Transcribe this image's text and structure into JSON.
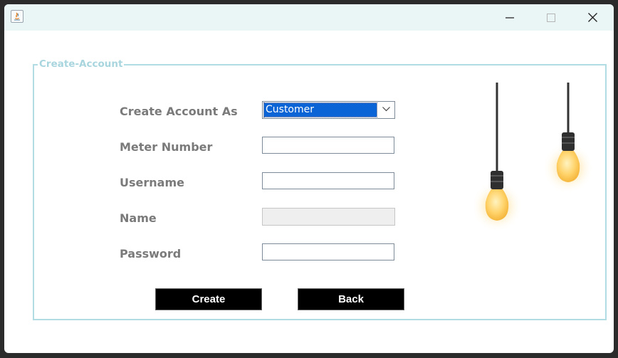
{
  "window": {
    "title": "",
    "controls": {
      "minimize": "minimize-icon",
      "maximize": "maximize-icon",
      "close": "close-icon"
    }
  },
  "panel": {
    "legend": "Create-Account"
  },
  "form": {
    "account_type": {
      "label": "Create Account As",
      "selected": "Customer"
    },
    "meter_number": {
      "label": "Meter Number",
      "value": ""
    },
    "username": {
      "label": "Username",
      "value": ""
    },
    "name": {
      "label": "Name",
      "value": ""
    },
    "password": {
      "label": "Password",
      "value": ""
    }
  },
  "buttons": {
    "create": "Create",
    "back": "Back"
  },
  "colors": {
    "accent_border": "#b2dce4",
    "legend_text": "#a8d5de",
    "label_text": "#7a7a7a",
    "selection": "#0a64d6",
    "button_bg": "#000000",
    "button_text": "#ffffff"
  },
  "decor": {
    "image": "hanging-light-bulbs"
  }
}
